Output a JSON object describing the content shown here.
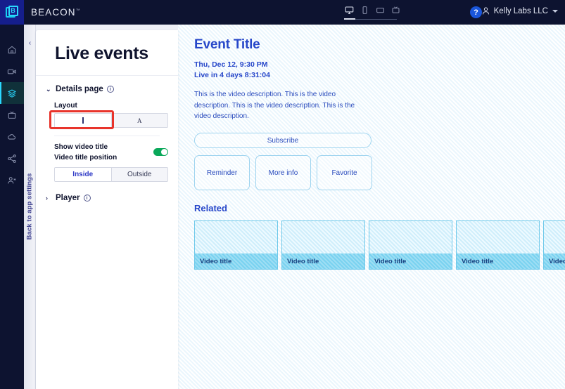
{
  "topbar": {
    "logo_letter": "B",
    "brand": "BEACON",
    "brand_tm": "™",
    "devices": [
      {
        "name": "desktop",
        "label": "Desktop",
        "active": true
      },
      {
        "name": "mobile",
        "label": "Mobile",
        "active": false
      },
      {
        "name": "tablet",
        "label": "Tablet",
        "active": false
      },
      {
        "name": "tv",
        "label": "TV",
        "active": false
      }
    ],
    "help_label": "?",
    "account_name": "Kelly Labs LLC"
  },
  "rail": {
    "items": [
      {
        "icon": "home-icon",
        "label": "Home",
        "active": false
      },
      {
        "icon": "video-camera-icon",
        "label": "Videos",
        "active": false
      },
      {
        "icon": "layers-icon",
        "label": "Collections",
        "active": true
      },
      {
        "icon": "tv-icon",
        "label": "Apps",
        "active": false
      },
      {
        "icon": "cloud-icon",
        "label": "Cloud",
        "active": false
      },
      {
        "icon": "share-icon",
        "label": "Distribution",
        "active": false
      },
      {
        "icon": "users-icon",
        "label": "Audience",
        "active": false
      }
    ]
  },
  "panel": {
    "back_label": "Back to app settings",
    "collapse_icon": "‹",
    "title": "Live events",
    "sections": [
      {
        "name": "details-page",
        "label": "Details page",
        "expanded": true,
        "chevron": "⌄",
        "info": "i"
      },
      {
        "name": "player",
        "label": "Player",
        "expanded": false,
        "chevron": "›",
        "info": "i"
      }
    ],
    "layout": {
      "label": "Layout",
      "options": [
        {
          "name": "layout-bar",
          "glyph": "bar",
          "selected": true
        },
        {
          "name": "layout-a",
          "glyph": "A",
          "selected": false
        }
      ],
      "focused": true,
      "focus_color": "#e8342b"
    },
    "video_title": {
      "show_label": "Show video title",
      "position_label": "Video title position",
      "enabled": true,
      "toggle_color": "#0aa85a",
      "options": [
        {
          "label": "Inside",
          "selected": true
        },
        {
          "label": "Outside",
          "selected": false
        }
      ]
    }
  },
  "preview": {
    "event_title": "Event Title",
    "event_date": "Thu, Dec 12, 9:30 PM",
    "event_countdown": "Live in 4 days 8:31:04",
    "description": "This is the video description. This is the video description. This is the video description. This is the video description.",
    "subscribe_label": "Subscribe",
    "action_buttons": [
      {
        "label": "Reminder"
      },
      {
        "label": "More info"
      },
      {
        "label": "Favorite"
      }
    ],
    "related_heading": "Related",
    "related_items": [
      {
        "title": "Video title"
      },
      {
        "title": "Video title"
      },
      {
        "title": "Video title"
      },
      {
        "title": "Video title"
      },
      {
        "title": "Video title"
      }
    ]
  },
  "colors": {
    "topbar_bg": "#0d1330",
    "logo_bg": "#151e8c",
    "accent_cyan": "#2ad8ff",
    "preview_blue": "#2747c9",
    "thumb_blue": "#79d2f0",
    "toggle_green": "#0aa85a",
    "focus_red": "#e8342b"
  }
}
